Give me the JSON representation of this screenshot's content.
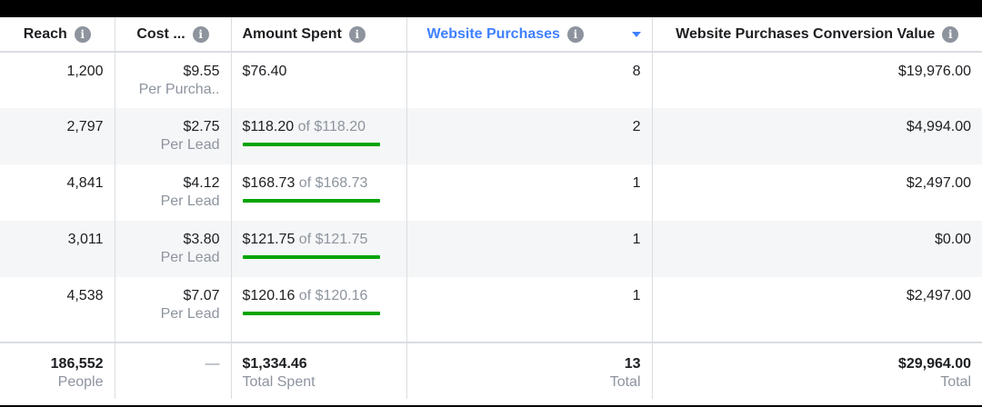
{
  "columns": [
    {
      "label": "Reach"
    },
    {
      "label": "Cost ..."
    },
    {
      "label": "Amount Spent"
    },
    {
      "label": "Website Purchases"
    },
    {
      "label": "Website Purchases Conversion Value"
    }
  ],
  "info_glyph": "i",
  "rows": [
    {
      "reach": "1,200",
      "cost": "$9.55",
      "cost_sub": "Per Purcha..",
      "spent": "$76.40",
      "spent_of": "",
      "budget_progress": null,
      "purchases": "8",
      "value": "$19,976.00"
    },
    {
      "reach": "2,797",
      "cost": "$2.75",
      "cost_sub": "Per Lead",
      "spent": "$118.20",
      "spent_of": " of $118.20",
      "budget_progress": 1.0,
      "purchases": "2",
      "value": "$4,994.00"
    },
    {
      "reach": "4,841",
      "cost": "$4.12",
      "cost_sub": "Per Lead",
      "spent": "$168.73",
      "spent_of": " of $168.73",
      "budget_progress": 1.0,
      "purchases": "1",
      "value": "$2,497.00"
    },
    {
      "reach": "3,011",
      "cost": "$3.80",
      "cost_sub": "Per Lead",
      "spent": "$121.75",
      "spent_of": " of $121.75",
      "budget_progress": 1.0,
      "purchases": "1",
      "value": "$0.00"
    },
    {
      "reach": "4,538",
      "cost": "$7.07",
      "cost_sub": "Per Lead",
      "spent": "$120.16",
      "spent_of": " of $120.16",
      "budget_progress": 1.0,
      "purchases": "1",
      "value": "$2,497.00"
    }
  ],
  "totals": {
    "reach": "186,552",
    "reach_sub": "People",
    "cost": "—",
    "spent": "$1,334.46",
    "spent_sub": "Total Spent",
    "purchases": "13",
    "purchases_sub": "Total",
    "value": "$29,964.00",
    "value_sub": "Total"
  },
  "colors": {
    "accent": "#4080ff",
    "progress": "#00a400"
  }
}
